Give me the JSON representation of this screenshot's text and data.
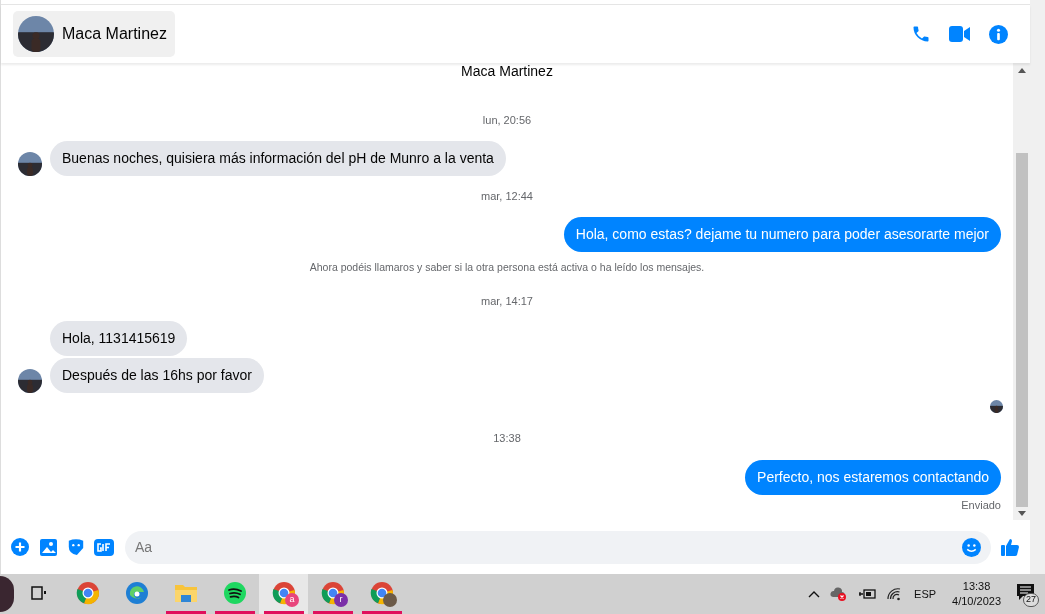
{
  "header": {
    "contact_name": "Maca Martinez"
  },
  "chat": {
    "top_name": "Maca Martinez",
    "messages": [
      {
        "kind": "time",
        "text": "lun, 20:56"
      },
      {
        "kind": "incoming",
        "text": "Buenas noches, quisiera más información del pH de Munro a la venta",
        "avatar": true
      },
      {
        "kind": "time",
        "text": "mar, 12:44"
      },
      {
        "kind": "outgoing",
        "text": "Hola, como estas? dejame tu numero para poder asesorarte mejor"
      },
      {
        "kind": "notice",
        "text": "Ahora podéis llamaros y saber si la otra persona está activa o ha leído los mensajes."
      },
      {
        "kind": "time",
        "text": "mar, 14:17"
      },
      {
        "kind": "incoming",
        "text": "Hola, 1131415619",
        "avatar": false
      },
      {
        "kind": "incoming",
        "text": "Después de las 16hs por favor",
        "avatar": true
      },
      {
        "kind": "seen"
      },
      {
        "kind": "time",
        "text": "13:38"
      },
      {
        "kind": "outgoing",
        "text": "Perfecto, nos estaremos contactando"
      },
      {
        "kind": "status",
        "text": "Enviado"
      }
    ]
  },
  "composer": {
    "placeholder": "Aa"
  },
  "taskbar": {
    "apps": [
      {
        "kind": "taskview",
        "open": false,
        "selected": false
      },
      {
        "kind": "chrome",
        "open": false,
        "selected": false
      },
      {
        "kind": "edge",
        "open": false,
        "selected": false
      },
      {
        "kind": "folder",
        "open": true,
        "selected": false
      },
      {
        "kind": "spotify",
        "open": true,
        "selected": false
      },
      {
        "kind": "chrome",
        "open": true,
        "selected": true,
        "badge": "a",
        "color": "#e8457c"
      },
      {
        "kind": "chrome",
        "open": true,
        "selected": false,
        "badge": "r",
        "color": "#7b2fa8"
      },
      {
        "kind": "chrome",
        "open": true,
        "selected": false,
        "badge_photo": true
      }
    ],
    "language": "ESP",
    "time": "13:38",
    "date": "4/10/2023",
    "notifications": "27"
  }
}
